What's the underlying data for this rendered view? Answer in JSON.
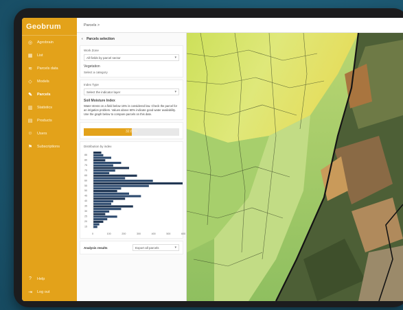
{
  "app": {
    "logo": "Geobrum"
  },
  "breadcrumb": "Parcels >",
  "sidebar": {
    "items": [
      {
        "icon": "globe-icon",
        "label": "Agrobrain",
        "active": false
      },
      {
        "icon": "grid-icon",
        "label": "List",
        "active": false
      },
      {
        "icon": "layers-icon",
        "label": "Parcels data",
        "active": false
      },
      {
        "icon": "box-icon",
        "label": "Models",
        "active": false
      },
      {
        "icon": "leaf-icon",
        "label": "Parcels",
        "active": true
      },
      {
        "icon": "chart-icon",
        "label": "Statistics",
        "active": false
      },
      {
        "icon": "doc-icon",
        "label": "Products",
        "active": false
      },
      {
        "icon": "user-icon",
        "label": "Users",
        "active": false
      },
      {
        "icon": "flag-icon",
        "label": "Subscriptions",
        "active": false
      }
    ],
    "bottom": [
      {
        "icon": "help-icon",
        "label": "Help"
      },
      {
        "icon": "logout-icon",
        "label": "Log out"
      }
    ]
  },
  "panel": {
    "header": "Parcels selection",
    "section1_label": "Work Zone",
    "section1_value": "All fields by parcel sector",
    "section1_sub1": "Vegetation",
    "section1_sub2": "Select a category",
    "section2_label": "Index Type",
    "section2_value": "Select the indicator layer",
    "info_title": "Soil Moisture Index",
    "info_text": "Water stress on a field below 15% is considered low. Check the parcel for an irrigation problem. Values above 60% indicate good water availability. Use the graph below to compare parcels on this date.",
    "progress_label": "32.65%",
    "progress": 0.5,
    "histogram_title": "Distribution by index",
    "footer_left": "Analysis results",
    "footer_select": "Export all parcels"
  },
  "colors": {
    "accent": "#e3a21a",
    "sidebar_text": "#fff7e2",
    "map_light": "#d9e36a",
    "map_field": "#9cc255",
    "map_dark": "#3d5a2a"
  },
  "histogram": {
    "values": [
      4,
      5,
      9,
      6,
      14,
      10,
      18,
      11,
      8,
      22,
      16,
      30,
      45,
      28,
      14,
      12,
      18,
      24,
      16,
      10,
      9,
      20,
      14,
      8,
      6,
      12,
      7,
      5,
      3,
      2
    ],
    "y_ticks": [
      "86",
      "80",
      "75",
      "70",
      "65",
      "60",
      "55",
      "50",
      "45",
      "40",
      "35",
      "30",
      "25",
      "20",
      "15"
    ],
    "x_ticks": [
      "0",
      "100",
      "200",
      "300",
      "400",
      "500",
      "600"
    ]
  }
}
